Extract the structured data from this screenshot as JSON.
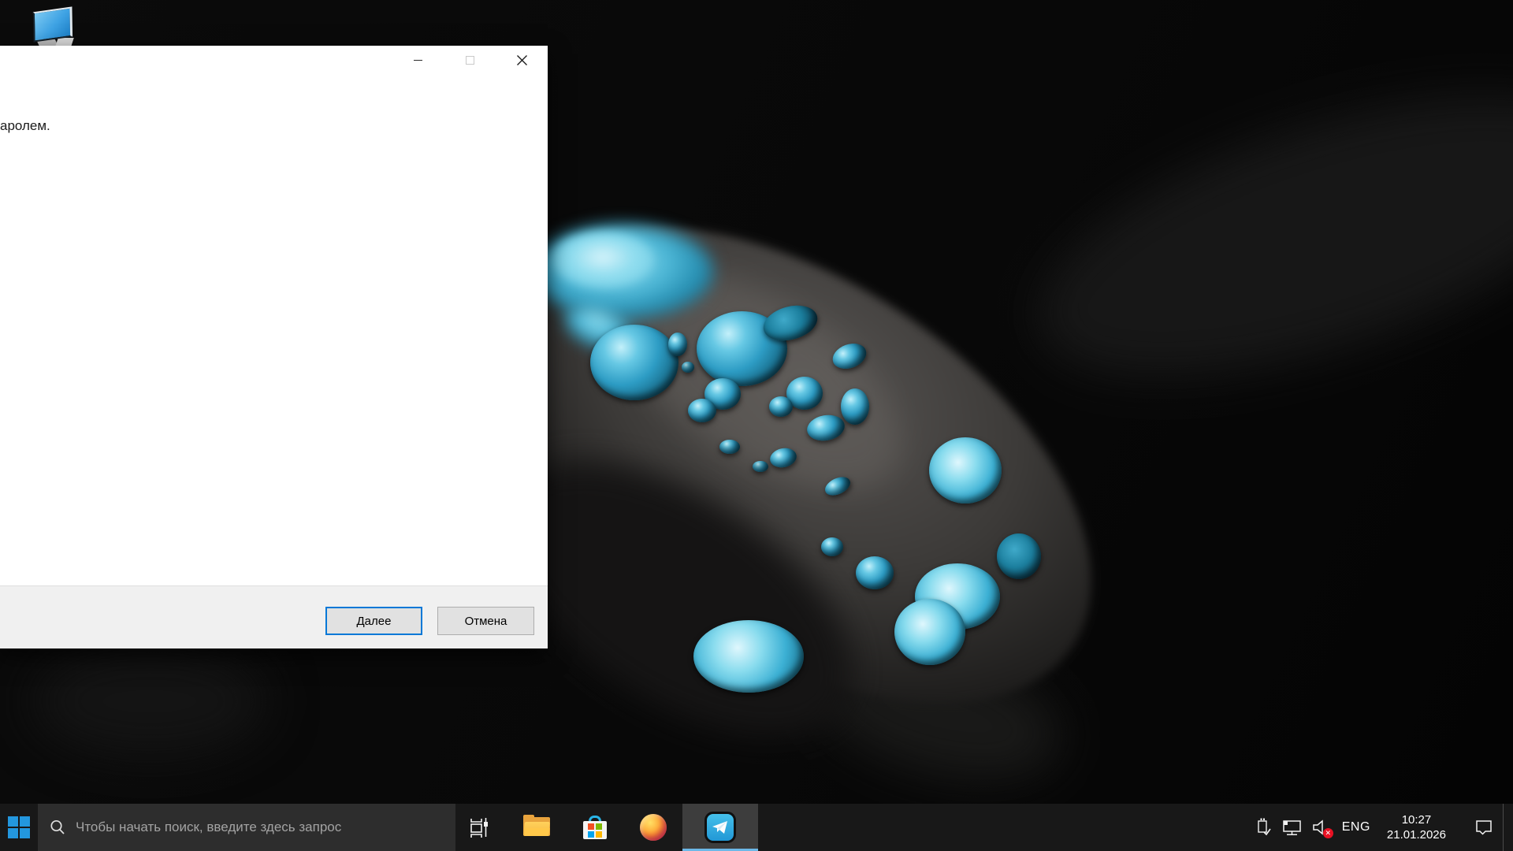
{
  "desktop": {
    "icons": [
      "this-pc"
    ]
  },
  "dialog": {
    "partial_text": "аролем.",
    "window_controls": [
      "minimize",
      "maximize-disabled",
      "close"
    ],
    "buttons": {
      "next": "Далее",
      "cancel": "Отмена"
    }
  },
  "taskbar": {
    "start": "start-button",
    "search": {
      "placeholder": "Чтобы начать поиск, введите здесь запрос"
    },
    "pinned_apps": [
      "task-view",
      "file-explorer",
      "microsoft-store",
      "firefox",
      "telegram"
    ],
    "active_app": "telegram",
    "tray": {
      "icons": [
        "usb-device",
        "network-ethernet",
        "volume-muted"
      ],
      "language": "ENG",
      "time": "10:27",
      "date": "21.01.2026",
      "action_center": "action-center"
    }
  },
  "colors": {
    "accent_blue": "#0078d7",
    "droplet_cyan": "#3db4d8",
    "telegram_blue": "#37aee2",
    "taskbar_bg": "#181818",
    "dialog_footer_bg": "#f0f0f0",
    "muted_badge_red": "#e81123"
  }
}
